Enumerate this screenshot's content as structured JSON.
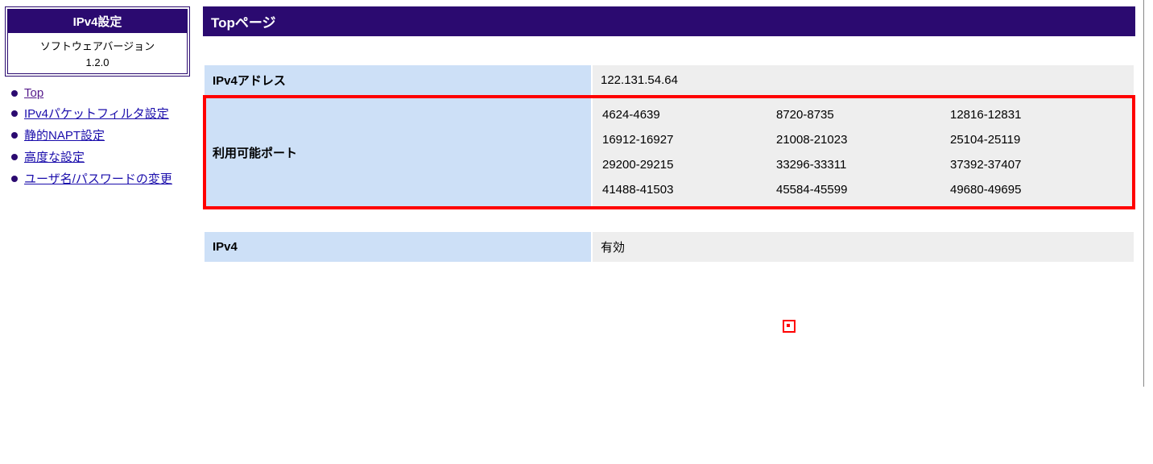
{
  "sidebar": {
    "title": "IPv4設定",
    "sw_label": "ソフトウェアバージョン",
    "sw_version": "1.2.0",
    "nav": [
      {
        "label": "Top",
        "visited": true
      },
      {
        "label": "IPv4パケットフィルタ設定",
        "visited": false
      },
      {
        "label": "静的NAPT設定",
        "visited": false
      },
      {
        "label": "高度な設定",
        "visited": false
      },
      {
        "label": "ユーザ名/パスワードの変更",
        "visited": false
      }
    ]
  },
  "main": {
    "title": "Topページ",
    "ipv4_addr_label": "IPv4アドレス",
    "ipv4_addr_value": "122.131.54.64",
    "ports_label": "利用可能ポート",
    "ports": [
      "4624-4639",
      "8720-8735",
      "12816-12831",
      "16912-16927",
      "21008-21023",
      "25104-25119",
      "29200-29215",
      "33296-33311",
      "37392-37407",
      "41488-41503",
      "45584-45599",
      "49680-49695"
    ],
    "ipv4_status_label": "IPv4",
    "ipv4_status_value": "有効"
  }
}
